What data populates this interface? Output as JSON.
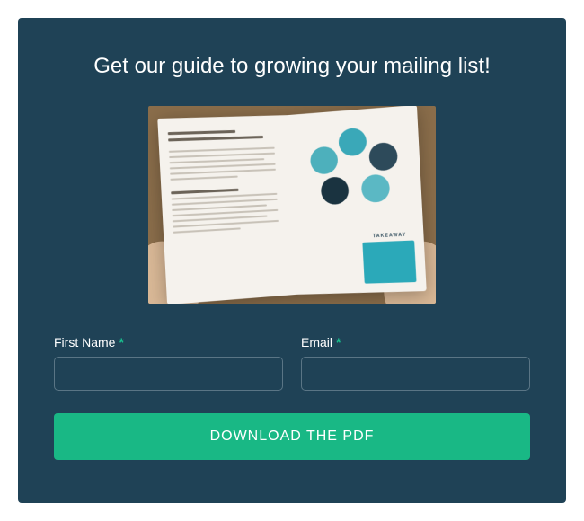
{
  "headline": "Get our guide to growing your mailing list!",
  "hero": {
    "takeaway_label": "TAKEAWAY"
  },
  "form": {
    "first_name": {
      "label": "First Name",
      "required_mark": "*",
      "value": ""
    },
    "email": {
      "label": "Email",
      "required_mark": "*",
      "value": ""
    },
    "submit_label": "DOWNLOAD THE PDF"
  },
  "colors": {
    "card_bg": "#1f4256",
    "accent": "#19b885",
    "required": "#19c08e"
  }
}
